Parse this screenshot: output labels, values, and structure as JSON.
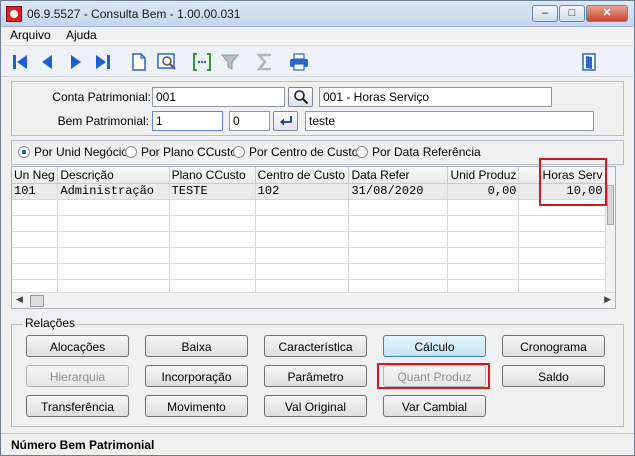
{
  "window": {
    "title": "06.9.5527 - Consulta Bem - 1.00.00.031"
  },
  "menu": {
    "items": [
      "Arquivo",
      "Ajuda"
    ]
  },
  "toolbar": {
    "icons": [
      "first-icon",
      "previous-icon",
      "next-icon",
      "last-icon",
      "new-document-icon",
      "preview-icon",
      "bracket-select-icon",
      "filter-icon",
      "sum-icon",
      "print-icon",
      "exit-door-icon"
    ]
  },
  "form": {
    "conta_label": "Conta Patrimonial:",
    "conta_value": "001",
    "conta_desc": "001 - Horas Serviço",
    "bem_label": "Bem Patrimonial:",
    "bem_value": "1",
    "bem_seq": "0",
    "bem_desc": "teste"
  },
  "sort_options": {
    "items": [
      "Por Unid Negócio",
      "Por Plano CCusto",
      "Por Centro de Custo",
      "Por Data Referência"
    ],
    "selected": 0
  },
  "table": {
    "columns": [
      "Un Neg",
      "Descrição",
      "Plano CCusto",
      "Centro de Custo",
      "Data Refer",
      "Unid Produz",
      "Horas Serv"
    ],
    "rows": [
      [
        "101",
        "Administração",
        "TESTE",
        "102",
        "31/08/2020",
        "0,00",
        "10,00"
      ]
    ]
  },
  "relations": {
    "title": "Relações",
    "buttons": [
      "Alocações",
      "Baixa",
      "Característica",
      "Cálculo",
      "Cronograma",
      "Hierarquia",
      "Incorporação",
      "Parâmetro",
      "Quant Produz",
      "Saldo",
      "Transferência",
      "Movimento",
      "Val Original",
      "Var Cambial"
    ]
  },
  "status": {
    "text": "Número  Bem Patrimonial"
  },
  "colors": {
    "highlight": "#d01818",
    "accent": "#3c7fb1"
  }
}
